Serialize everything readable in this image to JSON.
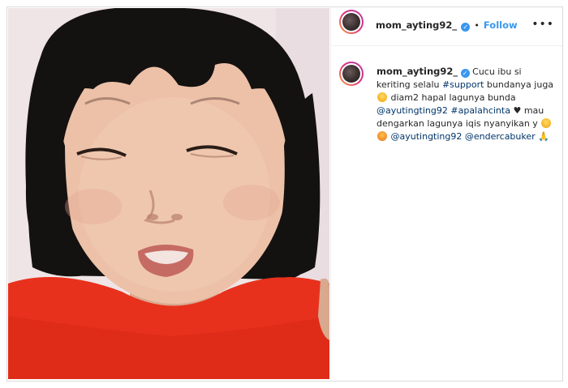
{
  "post": {
    "username": "mom_ayting92_",
    "follow_label": "Follow",
    "separator": "•",
    "more_label": "•••",
    "verified_glyph": "✓"
  },
  "caption": {
    "username": "mom_ayting92_",
    "t1": "Cucu ibu si keriting selalu ",
    "hashtag_support": "#support",
    "t2": " bundanya juga ",
    "t3": " diam2 hapal lagunya bunda ",
    "mention_ayu1": "@ayutingting92",
    "hashtag_apalahcinta": "#apalahcinta",
    "heart": "♥",
    "t4": " mau dengarkan lagunya iqis nyanyikan y ",
    "mention_ayu2": "@ayutingting92",
    "mention_ender": "@endercabuker",
    "pray": "🙏"
  },
  "colors": {
    "link": "#003569",
    "accent": "#3897f0",
    "shirt": "#e8311c"
  },
  "icons": [
    "verified-badge-icon",
    "more-options-icon",
    "smiling-face-emoji-icon",
    "heart-eyes-emoji-icon",
    "folded-hands-emoji-icon",
    "heart-icon"
  ]
}
